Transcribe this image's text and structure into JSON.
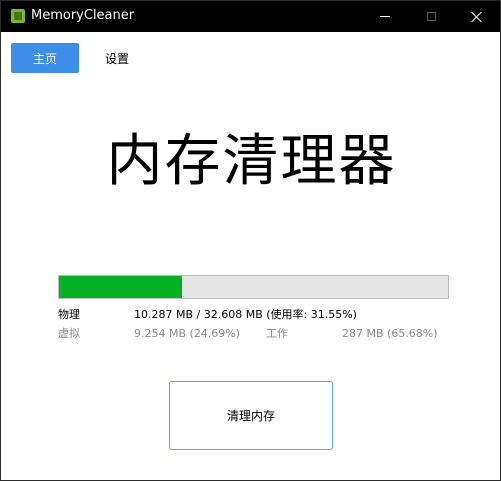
{
  "window": {
    "title": "MemoryCleaner",
    "icon": "memory-chip-icon",
    "controls": [
      "minimize-icon",
      "maximize-icon",
      "close-icon"
    ]
  },
  "tabs": [
    {
      "label": "主页",
      "active": true
    },
    {
      "label": "设置",
      "active": false
    }
  ],
  "main": {
    "heading": "内存清理器",
    "usage_fraction": 0.3155,
    "physical_label": "物理",
    "physical_value": "10.287 MB / 32.608 MB (使用率: 31.55%)",
    "virtual_label": "虚拟",
    "virtual_value": "9.254 MB (24.69%)",
    "working_label": "工作",
    "working_value": "287 MB (65.68%)",
    "clean_button": "清理内存"
  },
  "colors": {
    "accent": "#3d8ee6",
    "progress": "#06b025",
    "titlebar": "#000000"
  }
}
